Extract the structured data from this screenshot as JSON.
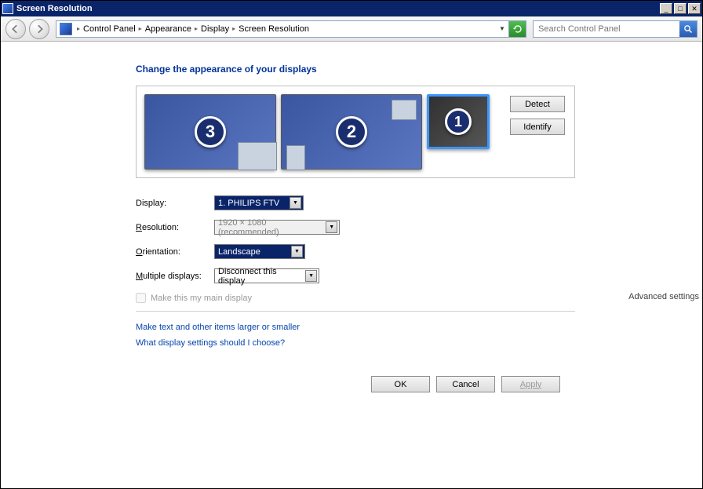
{
  "window": {
    "title": "Screen Resolution"
  },
  "breadcrumbs": {
    "item0": "Control Panel",
    "item1": "Appearance",
    "item2": "Display",
    "item3": "Screen Resolution"
  },
  "search": {
    "placeholder": "Search Control Panel"
  },
  "heading": "Change the appearance of your displays",
  "monitors": {
    "m3": "3",
    "m2": "2",
    "m1": "1"
  },
  "buttons": {
    "detect": "Detect",
    "identify": "Identify",
    "ok": "OK",
    "cancel": "Cancel",
    "apply": "Apply"
  },
  "form": {
    "display_label": "Display:",
    "display_value": "1. PHILIPS FTV",
    "resolution_label": "esolution:",
    "resolution_underline": "R",
    "resolution_value": "1920 × 1080 (recommended)",
    "orientation_label": "rientation:",
    "orientation_underline": "O",
    "orientation_value": "Landscape",
    "multiple_label": "ultiple displays:",
    "multiple_underline": "M",
    "multiple_value": "Disconnect this display",
    "main_display": "Make this my main display",
    "advanced": "Advanced settings"
  },
  "links": {
    "l1": "Make text and other items larger or smaller",
    "l2": "What display settings should I choose?"
  }
}
